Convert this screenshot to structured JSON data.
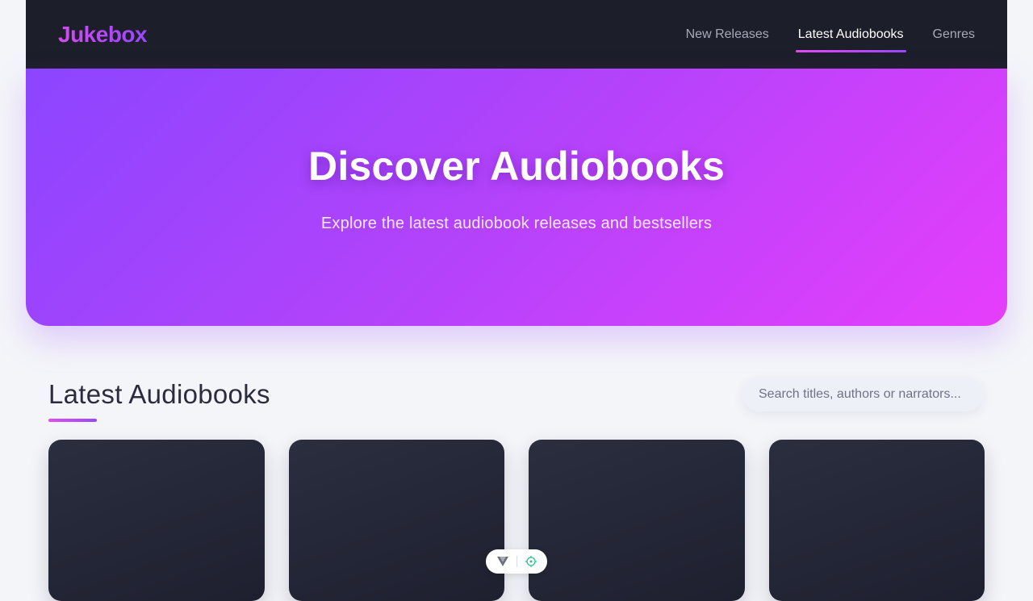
{
  "header": {
    "logo": "Jukebox",
    "nav": [
      {
        "label": "New Releases",
        "active": false
      },
      {
        "label": "Latest Audiobooks",
        "active": true
      },
      {
        "label": "Genres",
        "active": false
      }
    ]
  },
  "hero": {
    "title": "Discover Audiobooks",
    "subtitle": "Explore the latest audiobook releases and bestsellers"
  },
  "section": {
    "title": "Latest Audiobooks",
    "search_placeholder": "Search titles, authors or narrators..."
  },
  "cards_visible": 4,
  "devtools": {
    "icons": [
      "vue-logo-icon",
      "crosshair-icon"
    ]
  },
  "colors": {
    "header_bg": "#1c1e29",
    "accent_pink": "#e24bf2",
    "accent_purple": "#9a47ff",
    "page_bg": "#f4f5f9",
    "card_bg": "#23263a"
  }
}
